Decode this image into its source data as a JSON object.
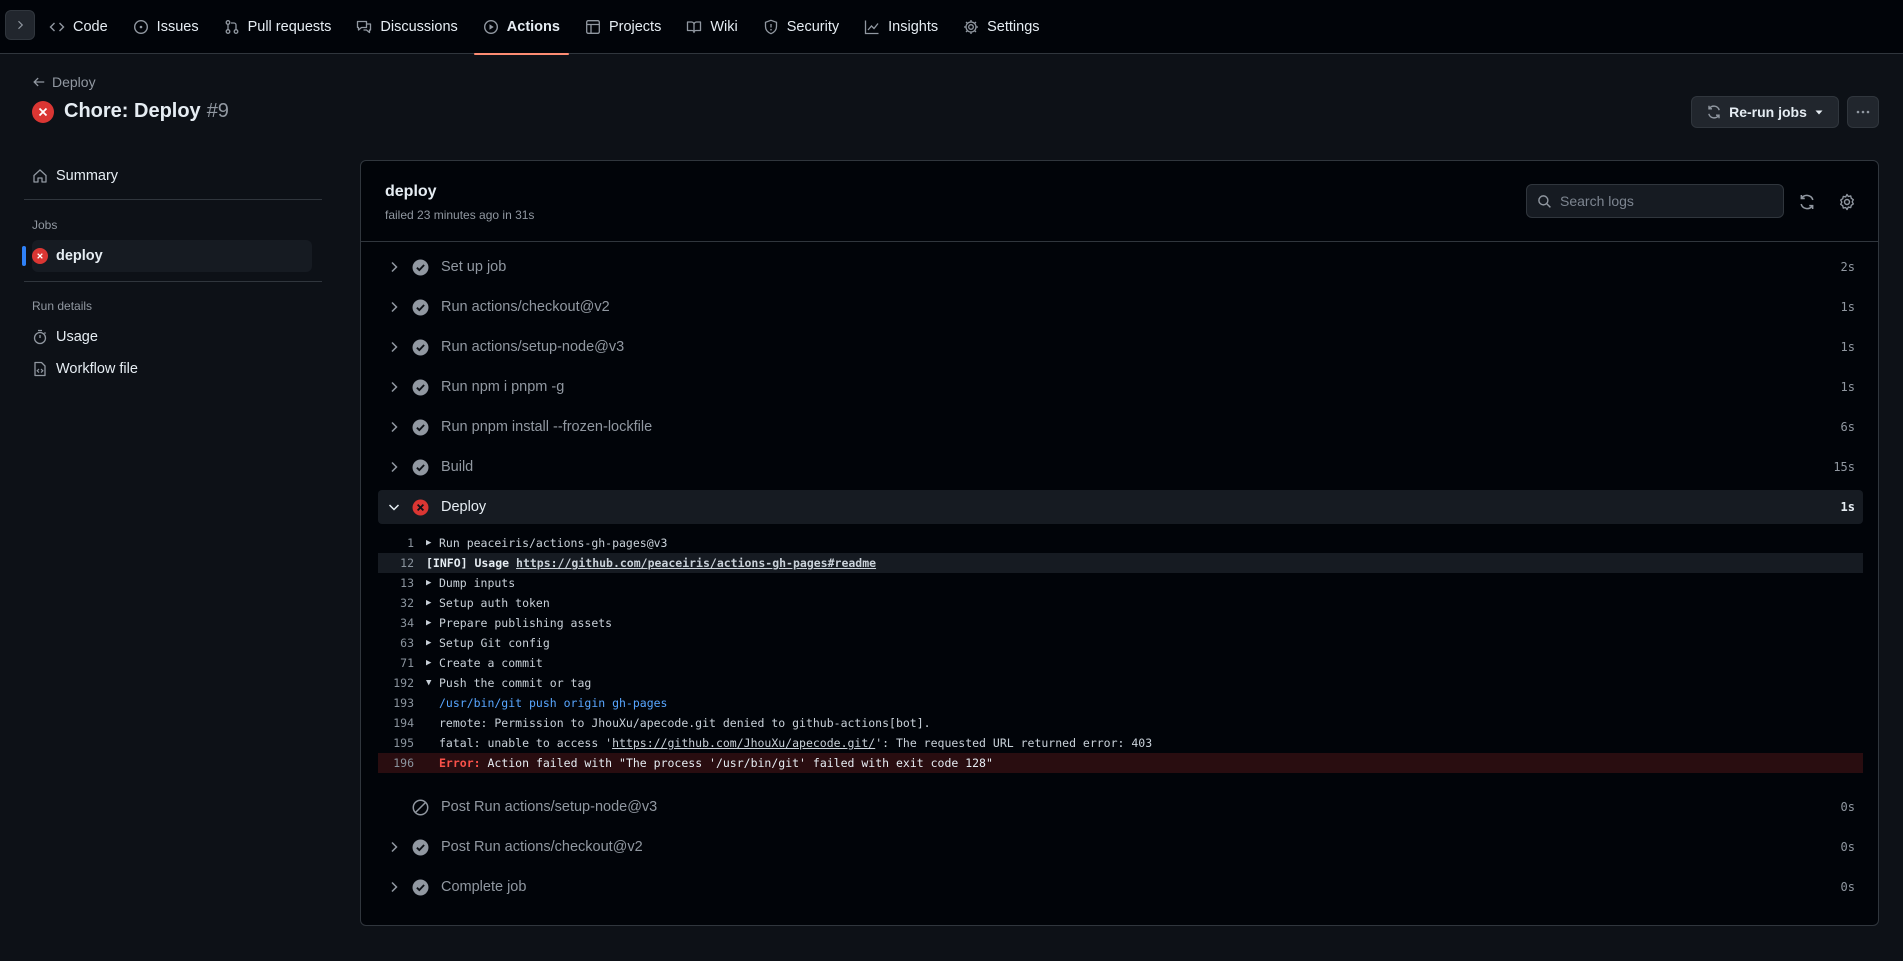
{
  "nav": {
    "tabs": [
      {
        "label": "Code",
        "icon": "code-icon"
      },
      {
        "label": "Issues",
        "icon": "issue-icon"
      },
      {
        "label": "Pull requests",
        "icon": "pull-request-icon"
      },
      {
        "label": "Discussions",
        "icon": "discussion-icon"
      },
      {
        "label": "Actions",
        "icon": "play-icon",
        "active": true
      },
      {
        "label": "Projects",
        "icon": "table-icon"
      },
      {
        "label": "Wiki",
        "icon": "book-icon"
      },
      {
        "label": "Security",
        "icon": "shield-icon"
      },
      {
        "label": "Insights",
        "icon": "graph-icon"
      },
      {
        "label": "Settings",
        "icon": "gear-icon"
      }
    ]
  },
  "header": {
    "back_label": "Deploy",
    "title": "Chore: Deploy",
    "run_number": "#9",
    "rerun_label": "Re-run jobs"
  },
  "sidebar": {
    "summary_label": "Summary",
    "jobs_heading": "Jobs",
    "job_label": "deploy",
    "run_details_heading": "Run details",
    "usage_label": "Usage",
    "workflow_label": "Workflow file"
  },
  "job": {
    "name": "deploy",
    "meta": "failed 23 minutes ago in 31s",
    "search_placeholder": "Search logs"
  },
  "steps": [
    {
      "name": "Set up job",
      "duration": "2s",
      "status": "success"
    },
    {
      "name": "Run actions/checkout@v2",
      "duration": "1s",
      "status": "success"
    },
    {
      "name": "Run actions/setup-node@v3",
      "duration": "1s",
      "status": "success"
    },
    {
      "name": "Run npm i pnpm -g",
      "duration": "1s",
      "status": "success"
    },
    {
      "name": "Run pnpm install --frozen-lockfile",
      "duration": "6s",
      "status": "success"
    },
    {
      "name": "Build",
      "duration": "15s",
      "status": "success"
    },
    {
      "name": "Deploy",
      "duration": "1s",
      "status": "failure",
      "expanded": true
    },
    {
      "name": "Post Run actions/setup-node@v3",
      "duration": "0s",
      "status": "skipped"
    },
    {
      "name": "Post Run actions/checkout@v2",
      "duration": "0s",
      "status": "success"
    },
    {
      "name": "Complete job",
      "duration": "0s",
      "status": "success"
    }
  ],
  "log": {
    "l1": {
      "num": "1",
      "text": "Run peaceiris/actions-gh-pages@v3"
    },
    "l12": {
      "num": "12",
      "prefix": "[INFO] Usage",
      "link": "https://github.com/peaceiris/actions-gh-pages#readme"
    },
    "l13": {
      "num": "13",
      "text": "Dump inputs"
    },
    "l32": {
      "num": "32",
      "text": "Setup auth token"
    },
    "l34": {
      "num": "34",
      "text": "Prepare publishing assets"
    },
    "l63": {
      "num": "63",
      "text": "Setup Git config"
    },
    "l71": {
      "num": "71",
      "text": "Create a commit"
    },
    "l192": {
      "num": "192",
      "text": "Push the commit or tag"
    },
    "l193": {
      "num": "193",
      "text": "/usr/bin/git push origin gh-pages"
    },
    "l194": {
      "num": "194",
      "text": "remote: Permission to JhouXu/apecode.git denied to github-actions[bot]."
    },
    "l195": {
      "num": "195",
      "before": "fatal: unable to access '",
      "link": "https://github.com/JhouXu/apecode.git/",
      "after": "': The requested URL returned error: 403"
    },
    "l196": {
      "num": "196",
      "label": "Error:",
      "text": "Action failed with \"The process '/usr/bin/git' failed with exit code 128\""
    }
  },
  "colors": {
    "failure": "#da3633",
    "accent": "#fd8c73",
    "link": "#58a6ff",
    "success": "#9198a1"
  }
}
